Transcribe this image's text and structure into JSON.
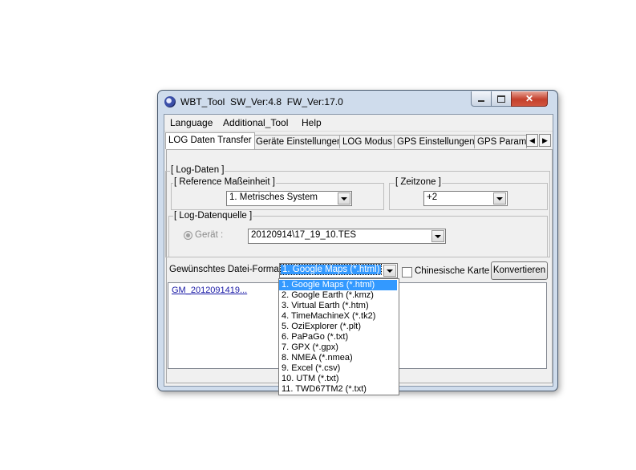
{
  "window": {
    "title": "WBT_Tool  SW_Ver:4.8  FW_Ver:17.0",
    "close_symbol": "✕"
  },
  "menu": [
    "Language",
    "Additional_Tool",
    "Help"
  ],
  "tabs": [
    "LOG Daten Transfer",
    "Geräte Einstellungen",
    "LOG Modus",
    "GPS Einstellungen",
    "GPS Param"
  ],
  "tab_scroll": {
    "left": "◀",
    "right": "▶"
  },
  "log_data": {
    "legend": "[ Log-Daten ]",
    "unit_legend": "[ Reference Maßeinheit ]",
    "unit_value": "1. Metrisches System",
    "timezone_legend": "[ Zeitzone ]",
    "timezone_value": "+2",
    "source_legend": "[ Log-Datenquelle ]",
    "device_label": "Gerät :",
    "device_value": "20120914\\17_19_10.TES"
  },
  "format": {
    "label": "Gewünschtes Datei-Format:",
    "selected": "1. Google Maps (*.html)",
    "chinese_label": "Chinesische Karte",
    "convert_button": "Konvertieren",
    "output_link": "GM_2012091419..."
  },
  "format_options": [
    "1. Google Maps (*.html)",
    "2. Google Earth (*.kmz)",
    "3. Virtual Earth (*.htm)",
    "4. TimeMachineX (*.tk2)",
    "5. OziExplorer (*.plt)",
    "6. PaPaGo (*.txt)",
    "7. GPX (*.gpx)",
    "8. NMEA (*.nmea)",
    "9. Excel (*.csv)",
    "10. UTM (*.txt)",
    "11. TWD67TM2 (*.txt)"
  ],
  "selected_option_index": 0,
  "colors": {
    "selection": "#3399ff",
    "link": "#1a1aa6",
    "close_button": "#c4402c"
  }
}
